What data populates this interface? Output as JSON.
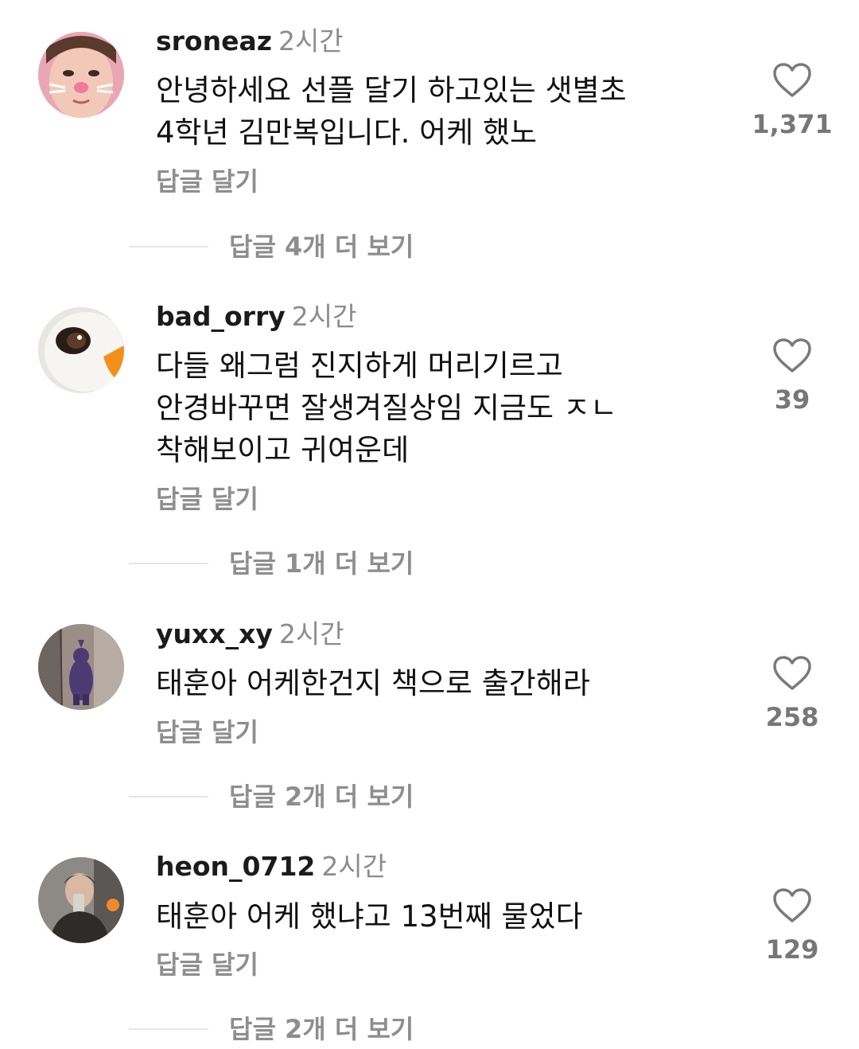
{
  "comments": [
    {
      "username": "sroneaz",
      "time": "2시간",
      "text": "안녕하세요 선플 달기 하고있는 샛별초\n4학년 김만복입니다. 어케 했노",
      "likes": "1,371",
      "reply_label": "답글 달기",
      "more_replies": "답글 4개 더 보기",
      "avatar_icon": "child-face-avatar"
    },
    {
      "username": "bad_orry",
      "time": "2시간",
      "text": "다들 왜그럼 진지하게 머리기르고\n안경바꾸면 잘생겨질상임 지금도 ㅈㄴ\n착해보이고 귀여운데",
      "likes": "39",
      "reply_label": "답글 달기",
      "more_replies": "답글 1개 더 보기",
      "avatar_icon": "white-duck-avatar"
    },
    {
      "username": "yuxx_xy",
      "time": "2시간",
      "text": "태훈아 어케한건지 책으로 출간해라",
      "likes": "258",
      "reply_label": "답글 달기",
      "more_replies": "답글 2개 더 보기",
      "avatar_icon": "purple-teletubby-avatar"
    },
    {
      "username": "heon_0712",
      "time": "2시간",
      "text": "태훈아 어케 했냐고 13번째 물었다",
      "likes": "129",
      "reply_label": "답글 달기",
      "more_replies": "답글 2개 더 보기",
      "avatar_icon": "mirror-selfie-avatar"
    }
  ],
  "colors": {
    "username": "#1b1b1b",
    "muted": "#8e8e8e",
    "divider": "#e6e6e6"
  }
}
